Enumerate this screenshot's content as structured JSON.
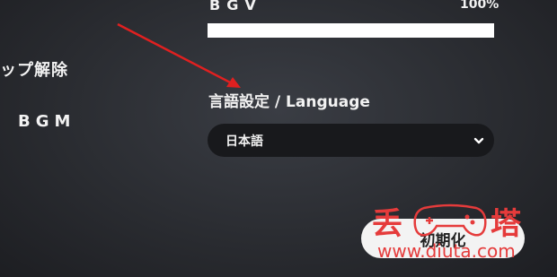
{
  "sidebar": {
    "items": [
      {
        "label": "ップ解除"
      },
      {
        "label": "BGM"
      }
    ]
  },
  "bgv": {
    "label": "BGV",
    "value_text": "100%",
    "level_percent": 100
  },
  "language": {
    "heading": "言語設定 / Language",
    "selected": "日本語"
  },
  "buttons": {
    "reset_label": "初期化"
  },
  "watermark": {
    "left_char": "丢",
    "right_char": "塔",
    "url": "www.diuta.com"
  },
  "colors": {
    "annotation_arrow": "#e02020",
    "watermark": "#e53b3b"
  },
  "icons": {
    "select": "chevron-down-icon",
    "watermark": "gamepad-icon"
  }
}
